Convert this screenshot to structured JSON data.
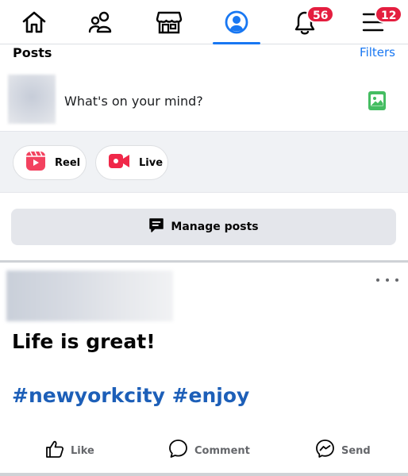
{
  "nav": {
    "items": [
      {
        "icon": "home-icon"
      },
      {
        "icon": "friends-icon"
      },
      {
        "icon": "marketplace-icon"
      },
      {
        "icon": "profile-icon",
        "active": true
      },
      {
        "icon": "bell-icon",
        "badge": "56"
      },
      {
        "icon": "menu-icon",
        "badge": "12"
      }
    ],
    "accent": "#1877f2",
    "badge_color": "#e41e3f"
  },
  "posts_header": {
    "title": "Posts",
    "filters": "Filters"
  },
  "composer": {
    "prompt": "What's on your mind?",
    "photo_icon": "photo-icon"
  },
  "actions": {
    "reel": "Reel",
    "live": "Live"
  },
  "manage": {
    "label": "Manage posts",
    "icon": "chat-bubble-icon"
  },
  "post": {
    "text": "Life is great!",
    "hashtags": [
      "#newyorkcity",
      "#enjoy"
    ],
    "hashtag_color": "#1d5fb8",
    "actions": {
      "like": "Like",
      "comment": "Comment",
      "send": "Send"
    }
  }
}
